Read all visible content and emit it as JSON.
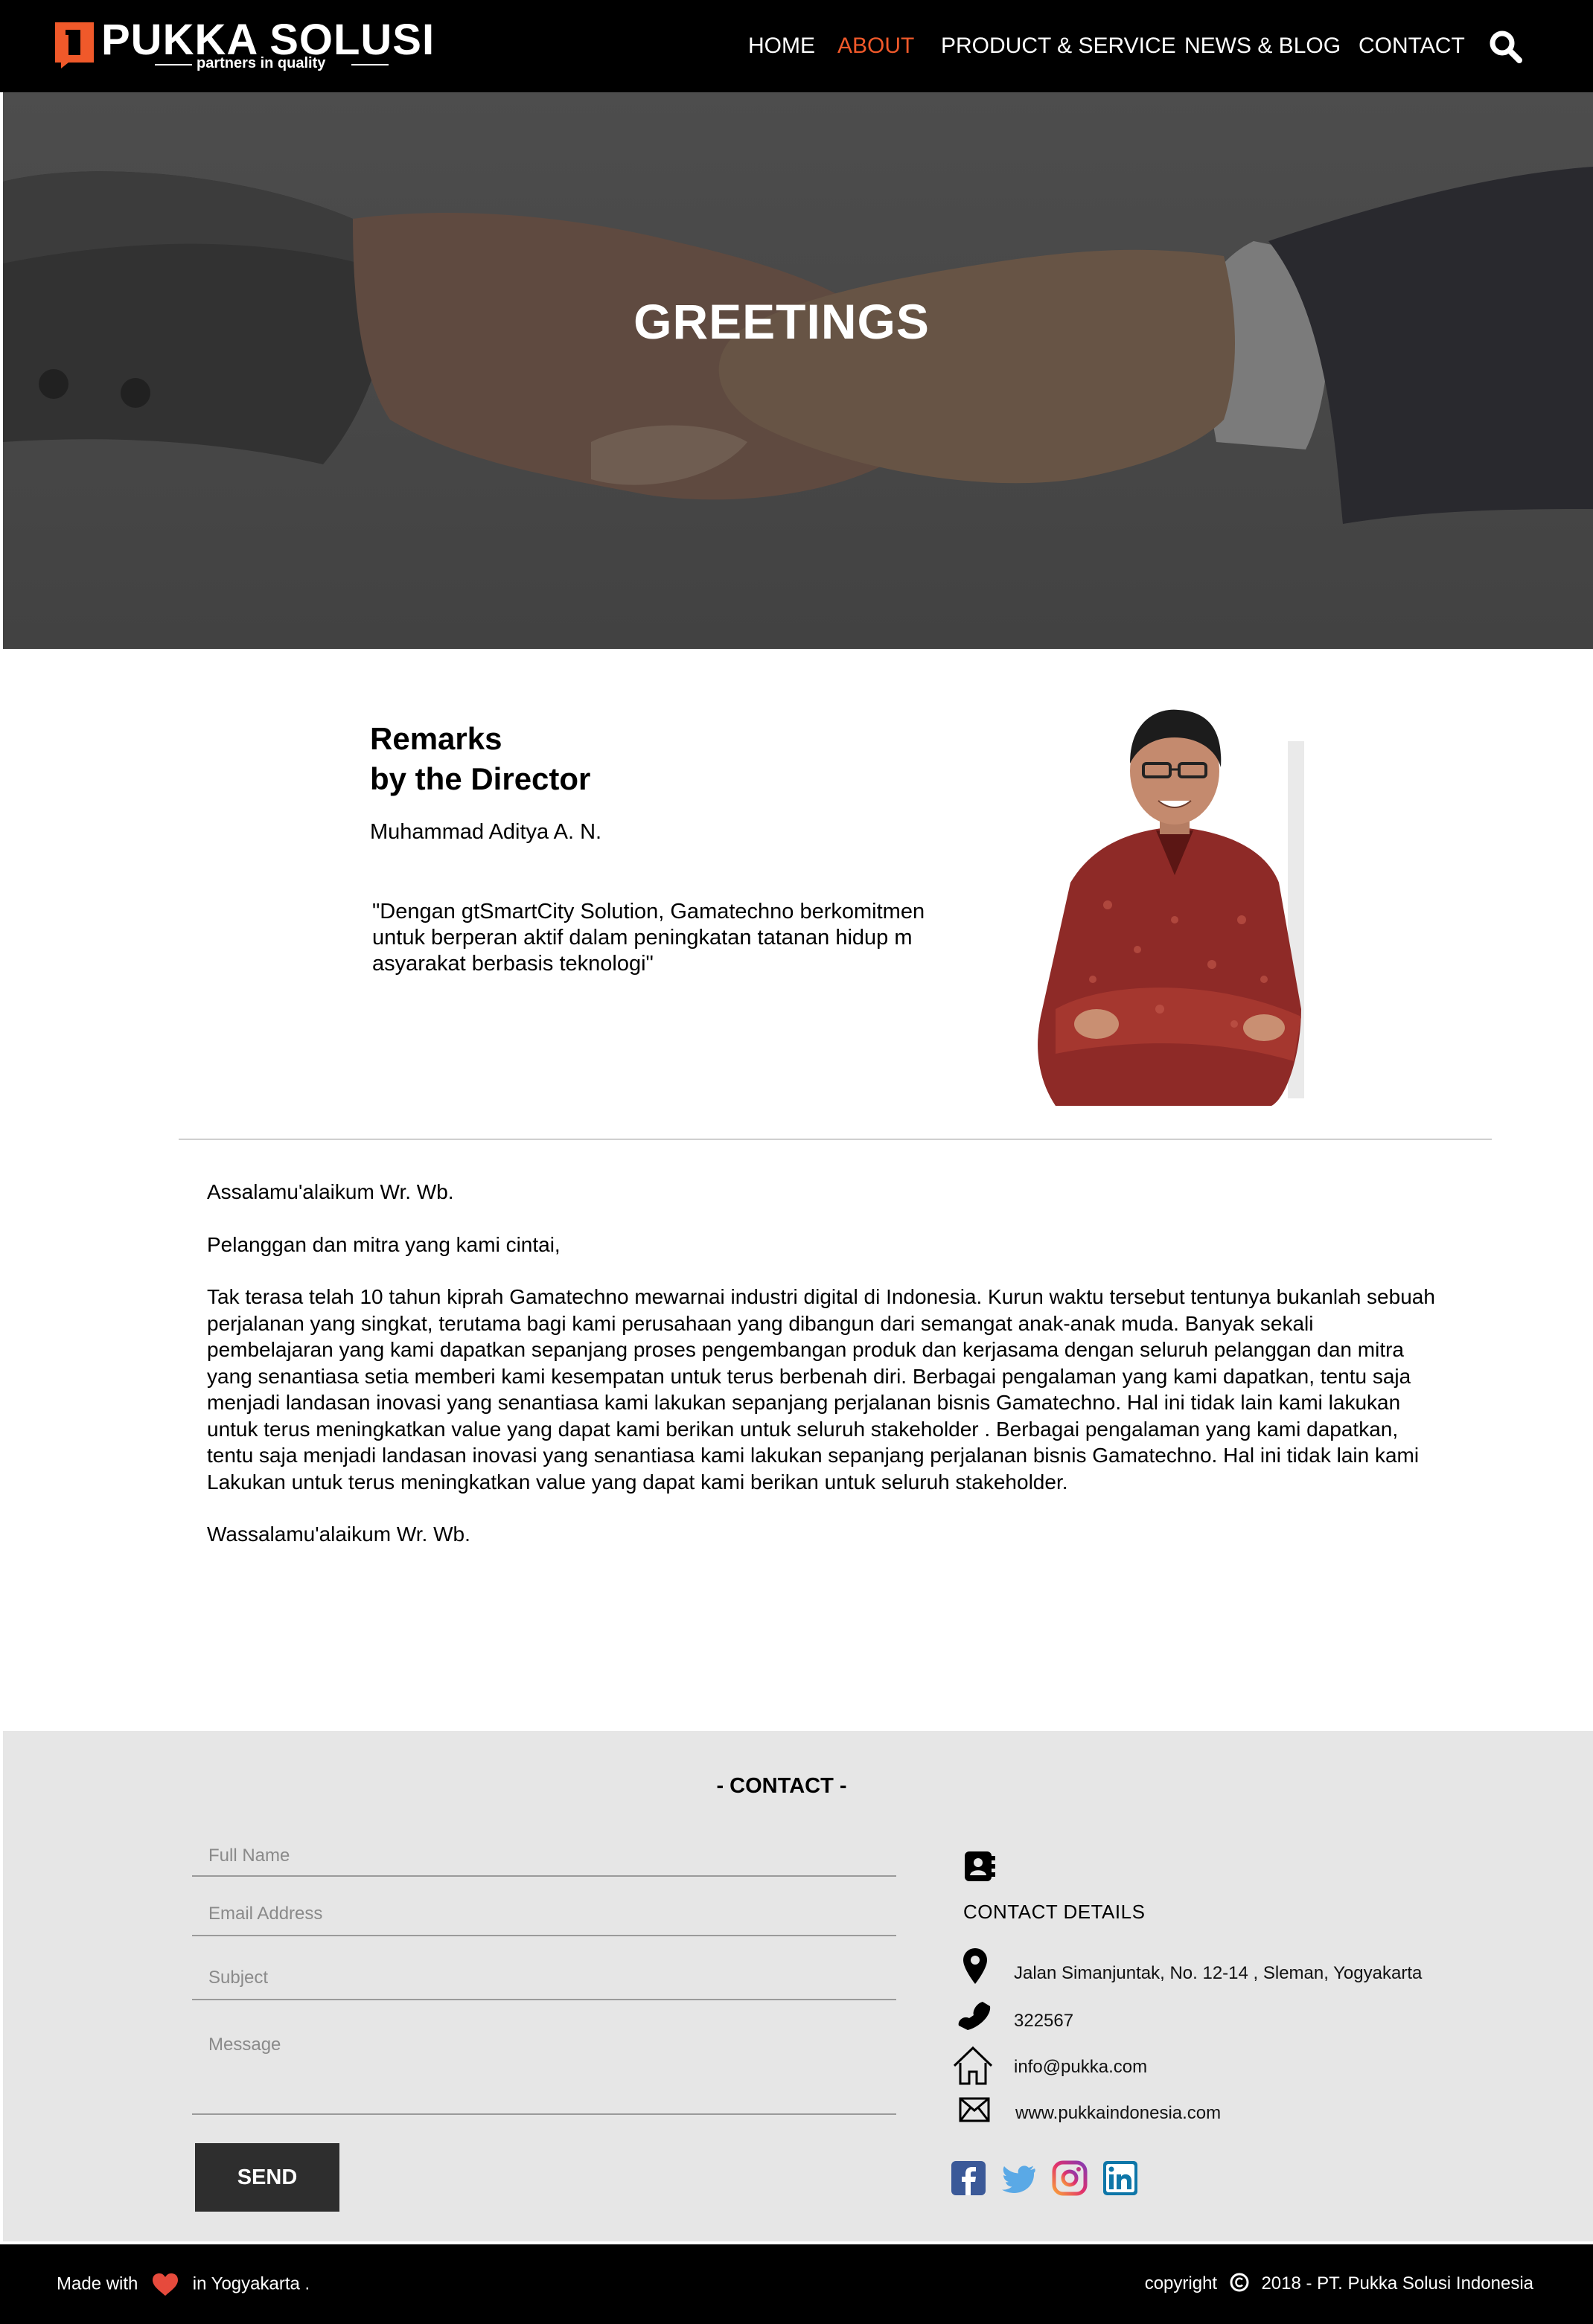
{
  "brand": {
    "name": "PUKKA SOLUSI",
    "tagline": "partners in quality",
    "accent_color": "#f0592a"
  },
  "nav": {
    "items": [
      {
        "label": "HOME",
        "active": false
      },
      {
        "label": "ABOUT",
        "active": true
      },
      {
        "label": "PRODUCT & SERVICE",
        "active": false
      },
      {
        "label": "NEWS & BLOG",
        "active": false
      },
      {
        "label": "CONTACT",
        "active": false
      }
    ],
    "search_icon": "search-icon"
  },
  "hero": {
    "title": "GREETINGS",
    "image": "handshake-image"
  },
  "remarks": {
    "title_line1": "Remarks",
    "title_line2": "by the Director",
    "name": "Muhammad Aditya A. N.",
    "quote": "\"Dengan gtSmartCity Solution, Gamatechno berkomitmen untuk berperan aktif dalam peningkatan tatanan hidup m asyarakat berbasis teknologi\"",
    "photo": "director-portrait"
  },
  "letter": {
    "greeting": "Assalamu'alaikum Wr. Wb.",
    "salutation": "Pelanggan dan mitra yang kami cintai,",
    "body": "Tak terasa telah 10 tahun kiprah Gamatechno mewarnai industri digital di Indonesia. Kurun waktu tersebut tentunya bukanlah sebuah perjalanan yang singkat, terutama bagi kami perusahaan yang dibangun dari semangat anak-anak muda. Banyak sekali pembelajaran yang kami dapatkan sepanjang proses pengembangan produk dan kerjasama dengan seluruh pelanggan dan mitra yang senantiasa setia memberi kami kesempatan untuk terus berbenah diri. Berbagai pengalaman yang kami dapatkan,  tentu saja menjadi landasan inovasi yang senantiasa kami lakukan sepanjang perjalanan bisnis Gamatechno. Hal ini tidak lain kami lakukan untuk terus meningkatkan value yang dapat kami berikan untuk seluruh stakeholder . Berbagai pengalaman yang kami dapatkan,  tentu saja menjadi landasan inovasi yang senantiasa kami lakukan sepanjang perjalanan bisnis Gamatechno. Hal ini tidak lain kami  Lakukan untuk terus meningkatkan value yang dapat kami berikan untuk seluruh stakeholder.",
    "closing": "Wassalamu'alaikum Wr. Wb."
  },
  "contact": {
    "title": "- CONTACT -",
    "form": {
      "full_name_placeholder": "Full Name",
      "email_placeholder": "Email Address",
      "subject_placeholder": "Subject",
      "message_placeholder": "Message",
      "send_label": "SEND"
    },
    "details_label": "CONTACT DETAILS",
    "address": "Jalan Simanjuntak, No. 12-14 , Sleman, Yogyakarta",
    "phone": "322567",
    "email": "info@pukka.com",
    "website": "www.pukkaindonesia.com",
    "social": [
      "facebook-icon",
      "twitter-icon",
      "instagram-icon",
      "linkedin-icon"
    ]
  },
  "footer": {
    "made_with": "Made with",
    "location": "in Yogyakarta .",
    "copyright_prefix": "copyright",
    "copyright_text": "2018 - PT. Pukka Solusi Indonesia"
  }
}
